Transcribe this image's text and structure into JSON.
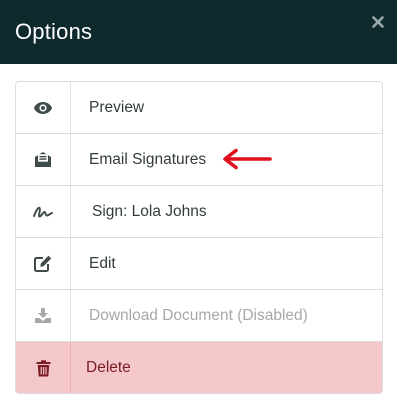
{
  "dialog": {
    "title": "Options",
    "close_label": "×"
  },
  "options": [
    {
      "label": "Preview",
      "icon": "eye-icon"
    },
    {
      "label": "Email Signatures",
      "icon": "envelope-open-icon"
    },
    {
      "label": "Sign: Lola Johns",
      "icon": "signature-icon"
    },
    {
      "label": "Edit",
      "icon": "edit-icon"
    },
    {
      "label": "Download Document (Disabled)",
      "icon": "download-icon",
      "disabled": true
    },
    {
      "label": "Delete",
      "icon": "trash-icon",
      "variant": "danger"
    }
  ],
  "annotation": {
    "icon": "red-arrow-left-icon",
    "color": "#e0101c"
  },
  "colors": {
    "header_bg": "#0f2a2c",
    "danger_bg": "#f4c7cb",
    "danger_text": "#7b1c24"
  }
}
